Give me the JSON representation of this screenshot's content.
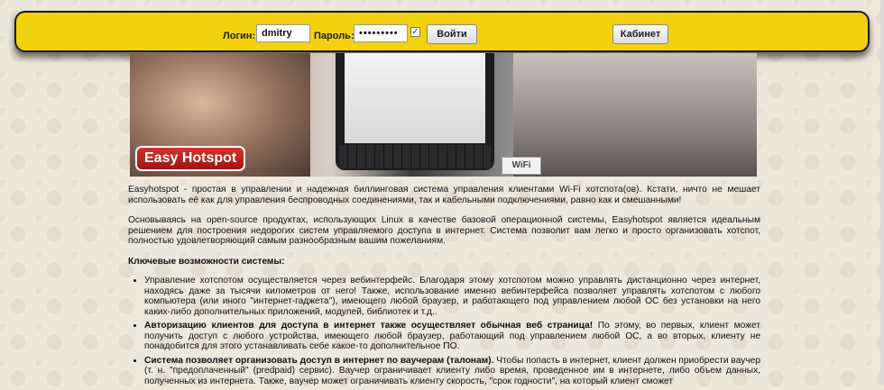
{
  "login": {
    "login_label": "Логин:",
    "login_value": "dmitry",
    "password_label": "Пароль:",
    "password_value": "•••••••••",
    "remember_checked": true,
    "submit_label": "Войти",
    "cabinet_label": "Кабинет"
  },
  "banner": {
    "brand_text": "Easy Hotspot",
    "sticker_text": "WiFi"
  },
  "content": {
    "intro_paragraph": "Easyhotspot - простая в управлении и надежная биллинговая система управления клиентами Wi-Fi хотспота(ов). Кстати, ничто не мешает использовать её как для управления беспроводных соединениями, так и кабельными подключениями, равно как и смешанными!",
    "second_paragraph": "Основываясь на open-source продуктах, использующих Linux в качестве базовой операционной системы, Easyhotspot является идеальным решением для построения недорогих систем управляемого доступа в интернет. Система позволит вам легко и просто организовать хотспот, полностью удовлетворяющий самым разнообразным вашим пожеланиям.",
    "features_heading": "Ключевые возможности системы:",
    "features": [
      {
        "bold": "",
        "text": "Управление хотспотом осуществляется через вебинтерфейс. Благодаря этому хотспотом можно управлять дистанционно через интернет, находясь даже за тысячи километров от него! Также, использование именно вебинтерфейса позволяет управлять хотспотом с любого компьютера (или иного \"интернет-гаджета\"), имеющего любой браузер, и работающего под управлением любой ОС без установки на него каких-либо дополнительных приложений, модулей, библиотек и т.д.."
      },
      {
        "bold": "Авторизацию клиентов для доступа в интернет также осуществляет обычная веб страница!",
        "text": " По этому, во первых, клиент может получить доступ с любого устройства, имеющего любой браузер, работающий под управлением любой ОС, а во вторых, клиенту не понадобится для этого устанавливать себе какое-то дополнительное ПО."
      },
      {
        "bold": "Система позволяет организовать доступ в интернет по ваучерам (талонам).",
        "text": " Чтобы попасть в интернет, клиент должен приобрести ваучер (т. н. \"предоплаченный\" (predpaid) сервис). Ваучер ограничивает клиенту либо время, проведенное им в интернете, либо объем данных, полученных из интернета. Также, ваучер может ограничивать клиенту скорость, \"срок годности\", на который клиент сможет"
      }
    ]
  },
  "colors": {
    "login_bar": "#f2d10e",
    "brand_red": "#c0241f",
    "page_bg": "#ece8dc"
  }
}
